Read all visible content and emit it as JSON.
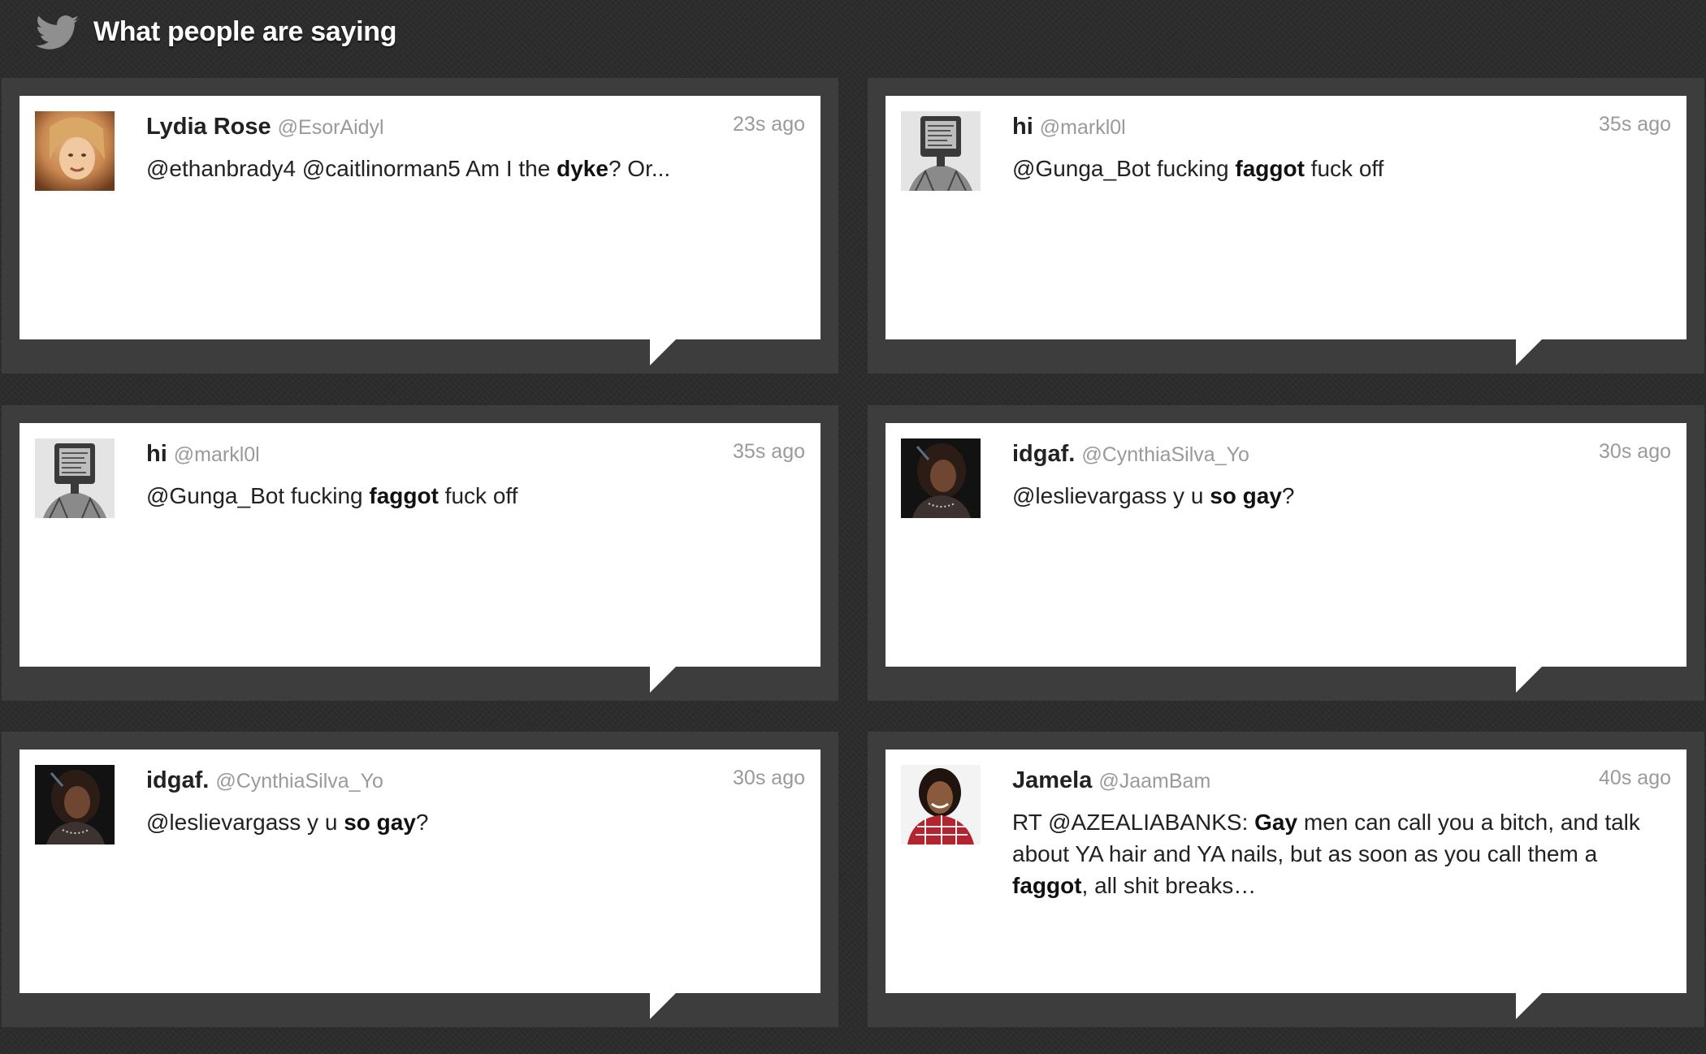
{
  "header": {
    "title": "What people are saying",
    "icon": "twitter-bird-icon"
  },
  "colors": {
    "page_background": "#2c2c2c",
    "card_frame": "#3d3d3d",
    "card_background": "#ffffff",
    "name_text": "#222222",
    "muted_text": "#9a9a9a"
  },
  "tweets": [
    {
      "name": "Lydia Rose",
      "handle": "@EsorAidyl",
      "time": "23s ago",
      "avatar": "photo-avatar",
      "segments": [
        {
          "text": "@ethanbrady4 @caitlinorman5 Am I the ",
          "bold": false
        },
        {
          "text": "dyke",
          "bold": true
        },
        {
          "text": "? Or...",
          "bold": false
        }
      ]
    },
    {
      "name": "hi",
      "handle": "@markl0l",
      "time": "35s ago",
      "avatar": "tv-sketch-avatar",
      "segments": [
        {
          "text": "@Gunga_Bot fucking ",
          "bold": false
        },
        {
          "text": "faggot",
          "bold": true
        },
        {
          "text": " fuck off",
          "bold": false
        }
      ]
    },
    {
      "name": "hi",
      "handle": "@markl0l",
      "time": "35s ago",
      "avatar": "tv-sketch-avatar",
      "segments": [
        {
          "text": "@Gunga_Bot fucking ",
          "bold": false
        },
        {
          "text": "faggot",
          "bold": true
        },
        {
          "text": " fuck off",
          "bold": false
        }
      ]
    },
    {
      "name": "idgaf.",
      "handle": "@CynthiaSilva_Yo",
      "time": "30s ago",
      "avatar": "dark-photo-avatar",
      "segments": [
        {
          "text": "@leslievargass y u ",
          "bold": false
        },
        {
          "text": "so gay",
          "bold": true
        },
        {
          "text": "?",
          "bold": false
        }
      ]
    },
    {
      "name": "idgaf.",
      "handle": "@CynthiaSilva_Yo",
      "time": "30s ago",
      "avatar": "dark-photo-avatar",
      "segments": [
        {
          "text": "@leslievargass y u ",
          "bold": false
        },
        {
          "text": "so gay",
          "bold": true
        },
        {
          "text": "?",
          "bold": false
        }
      ]
    },
    {
      "name": "Jamela",
      "handle": "@JaamBam",
      "time": "40s ago",
      "avatar": "smiling-photo-avatar",
      "segments": [
        {
          "text": "RT @AZEALIABANKS: ",
          "bold": false
        },
        {
          "text": "Gay",
          "bold": true
        },
        {
          "text": " men can call you a bitch, and talk about YA hair and YA nails, but as soon as you call them a ",
          "bold": false
        },
        {
          "text": "faggot",
          "bold": true
        },
        {
          "text": ", all shit breaks…",
          "bold": false
        }
      ]
    }
  ]
}
